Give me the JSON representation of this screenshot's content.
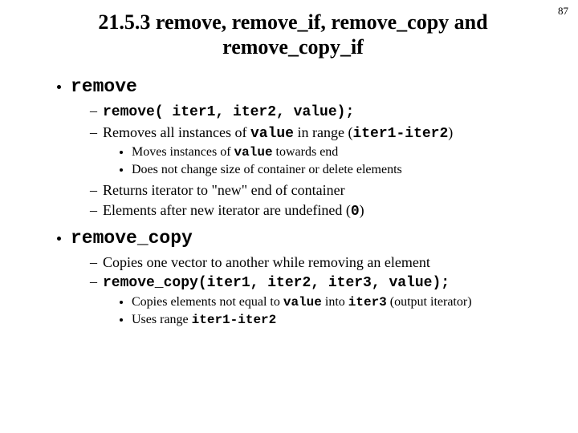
{
  "pageNumber": "87",
  "title": "21.5.3 remove, remove_if, remove_copy and remove_copy_if",
  "s1": {
    "head": "remove",
    "sig": "remove( iter1, iter2, value);",
    "b2a": "Removes all instances of ",
    "b2b": "value",
    "b2c": " in range (",
    "b2d": "iter1-iter2",
    "b2e": ")",
    "s1a": "Moves instances of ",
    "s1b": "value",
    "s1c": " towards end",
    "s2": "Does not change size of container or delete elements",
    "b3": "Returns iterator to \"new\" end of container",
    "b4a": "Elements after new iterator are undefined (",
    "b4b": "0",
    "b4c": ")"
  },
  "s2": {
    "head": "remove_copy",
    "b1": "Copies one vector to another while removing an element",
    "sig": "remove_copy(iter1, iter2, iter3, value);",
    "s1a": "Copies elements not equal to ",
    "s1b": "value",
    "s1c": " into ",
    "s1d": "iter3",
    "s1e": " (output iterator)",
    "s2a": "Uses range ",
    "s2b": "iter1-iter2"
  }
}
